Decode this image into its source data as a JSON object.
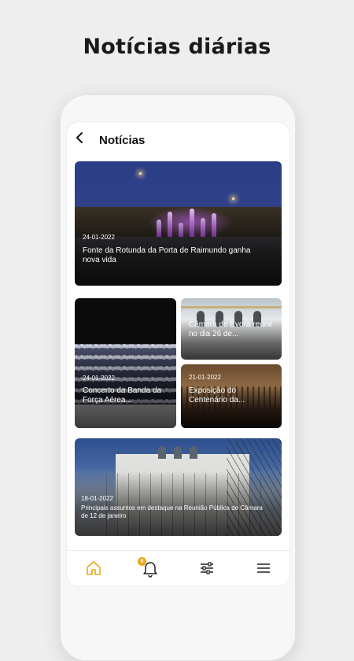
{
  "headline": "Notícias diárias",
  "screen": {
    "title": "Notícias",
    "back_icon": "chevron-left-icon"
  },
  "news": [
    {
      "date": "24-01-2022",
      "title": "Fonte da Rotunda da Porta de Raimundo ganha nova vida"
    },
    {
      "date": "24-01-2022",
      "title": "Concerto da Banda da Força Aérea..."
    },
    {
      "date": "",
      "title": "Câmara de Évora reúne no dia 26 de..."
    },
    {
      "date": "21-01-2022",
      "title": "Exposição do Centenário da..."
    },
    {
      "date": "18-01-2022",
      "title": "Principais assuntos em destaque na Reunião Pública de Câmara de 12 de janeiro"
    }
  ],
  "bottom_nav": {
    "items": [
      "home-icon",
      "bell-icon",
      "sliders-icon",
      "menu-icon"
    ],
    "notification_badge": "0",
    "accent_color": "#e9a818"
  }
}
